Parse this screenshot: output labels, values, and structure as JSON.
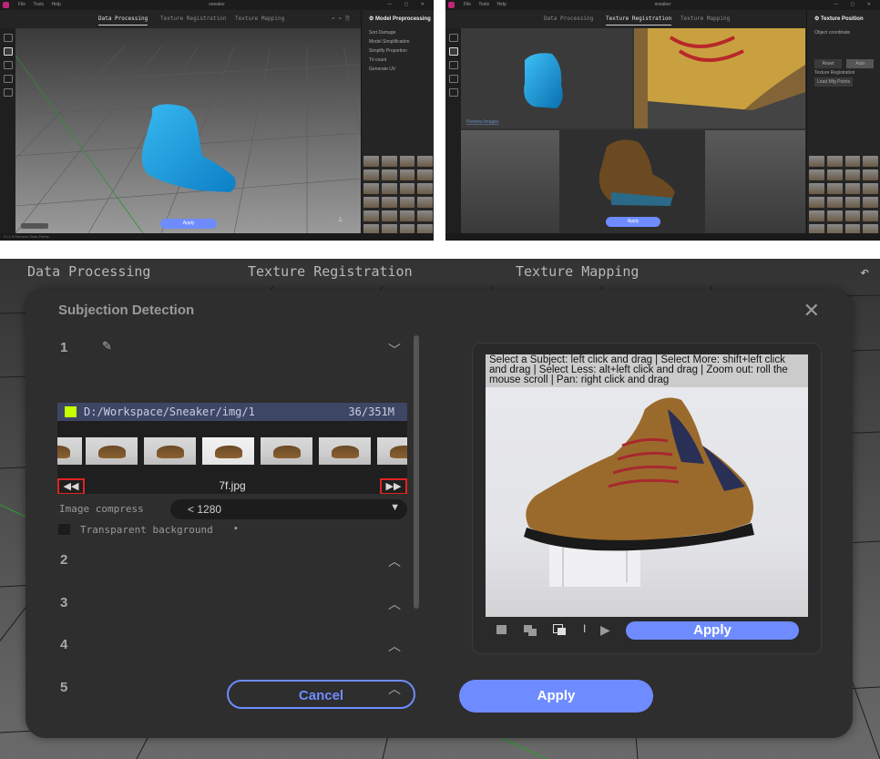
{
  "colors": {
    "accent": "#6e8cff",
    "accent_text": "#ffffff",
    "highlight_red": "#e02222",
    "app_logo": "#c0247a",
    "swatch_yellow": "#c6ff00"
  },
  "left_window": {
    "title": "sneaker",
    "menu": [
      "File",
      "Tools",
      "Help"
    ],
    "tabs": [
      "Data Processing",
      "Texture Registration",
      "Texture Mapping"
    ],
    "active_tab": 0,
    "panel": {
      "title": "Model Preprocessing",
      "rows": [
        "Sort Damage",
        "Model Simplification",
        "Simplify Proportion",
        "Tri count",
        "Generate UV"
      ]
    },
    "apply_label": "Apply",
    "status_text": "2 L1.0 Remove Scan Points"
  },
  "right_window": {
    "title": "sneaker",
    "menu": [
      "File",
      "Tools",
      "Help"
    ],
    "tabs": [
      "Data Processing",
      "Texture Registration",
      "Texture Mapping"
    ],
    "active_tab": 1,
    "panel": {
      "title": "Texture Position",
      "rows": [
        "Object coordinate",
        "Texture Registration"
      ],
      "buttons": [
        "Reset",
        "Auto",
        "Load Mfg Points"
      ]
    },
    "viewport_label": "Preview Images",
    "apply_label": "Apply"
  },
  "main": {
    "tabs": [
      "Data Processing",
      "Texture Registration",
      "Texture Mapping"
    ],
    "dialog": {
      "title": "Subjection Detection",
      "steps": [
        "1",
        "2",
        "3",
        "4",
        "5"
      ],
      "path": "D:/Workspace/Sneaker/img/1",
      "count": "36/351M",
      "current_file": "7f.jpg",
      "image_compress_label": "Image compress",
      "image_compress_value": "< 1280",
      "transparent_bg_label": "Transparent background",
      "preview_hint": "Select a Subject: left click and drag | Select More: shift+left click and drag | Select Less: alt+left click and drag | Zoom out: roll the mouse scroll | Pan: right click and drag",
      "preview_apply_label": "Apply",
      "cancel_label": "Cancel",
      "apply_label": "Apply",
      "nav_prev": "◀◀",
      "nav_next": "▶▶"
    }
  }
}
